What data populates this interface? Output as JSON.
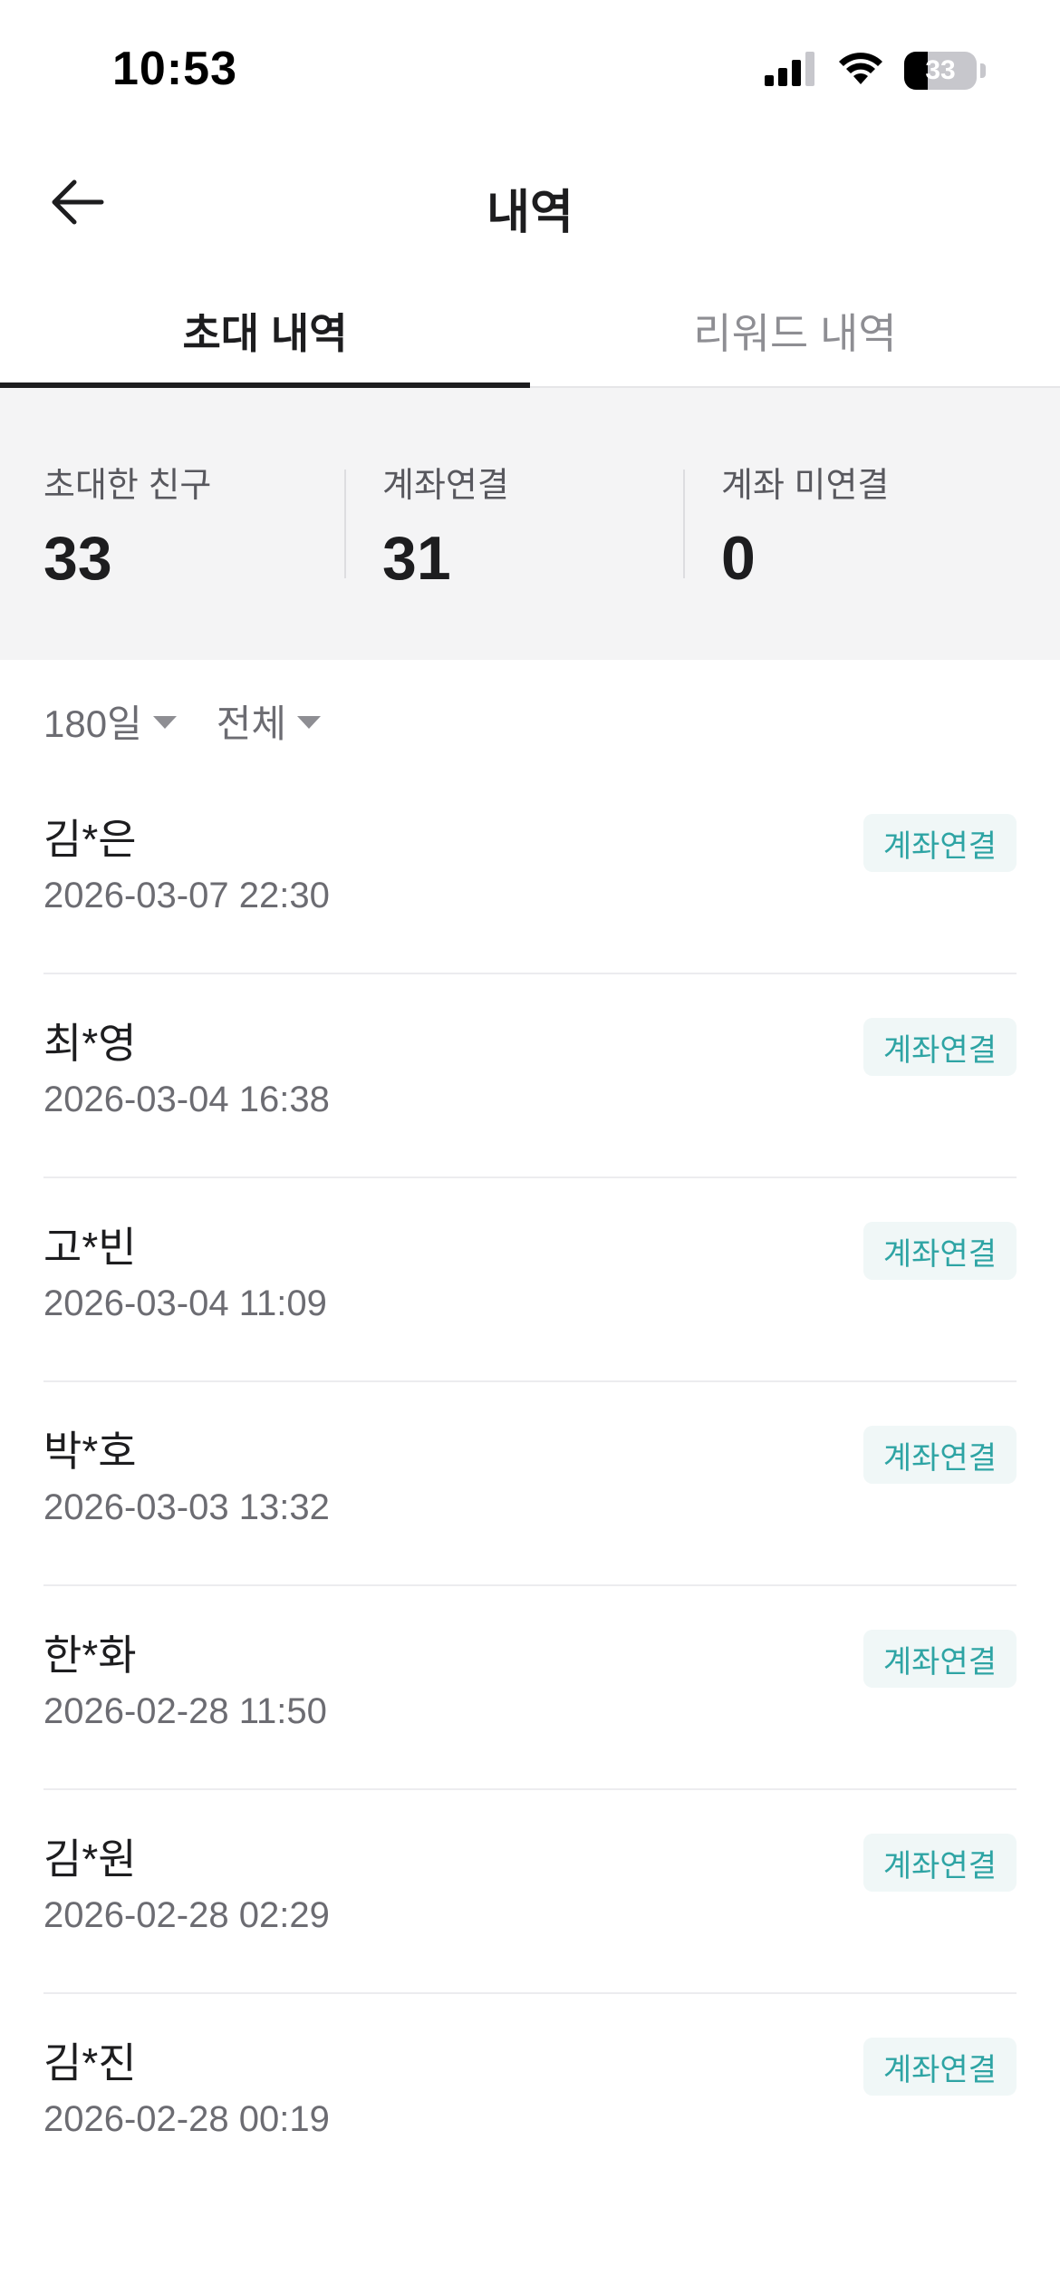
{
  "status_bar": {
    "time": "10:53",
    "battery": "33",
    "battery_level": 0.33
  },
  "header": {
    "title": "내역",
    "back_icon": "arrow-left-icon"
  },
  "tabs": [
    {
      "label": "초대 내역",
      "active": true
    },
    {
      "label": "리워드 내역",
      "active": false
    }
  ],
  "summary": [
    {
      "label": "초대한 친구",
      "value": "33"
    },
    {
      "label": "계좌연결",
      "value": "31"
    },
    {
      "label": "계좌 미연결",
      "value": "0"
    }
  ],
  "filters": [
    {
      "label": "180일"
    },
    {
      "label": "전체"
    }
  ],
  "colors": {
    "badge_text": "#2ea4a4",
    "badge_bg": "#f0f7f7",
    "summary_bg": "#f4f4f5"
  },
  "items": [
    {
      "name": "김*은",
      "date": "2026-03-07 22:30",
      "status": "계좌연결"
    },
    {
      "name": "최*영",
      "date": "2026-03-04 16:38",
      "status": "계좌연결"
    },
    {
      "name": "고*빈",
      "date": "2026-03-04 11:09",
      "status": "계좌연결"
    },
    {
      "name": "박*호",
      "date": "2026-03-03 13:32",
      "status": "계좌연결"
    },
    {
      "name": "한*화",
      "date": "2026-02-28 11:50",
      "status": "계좌연결"
    },
    {
      "name": "김*원",
      "date": "2026-02-28 02:29",
      "status": "계좌연결"
    },
    {
      "name": "김*진",
      "date": "2026-02-28 00:19",
      "status": "계좌연결"
    }
  ]
}
